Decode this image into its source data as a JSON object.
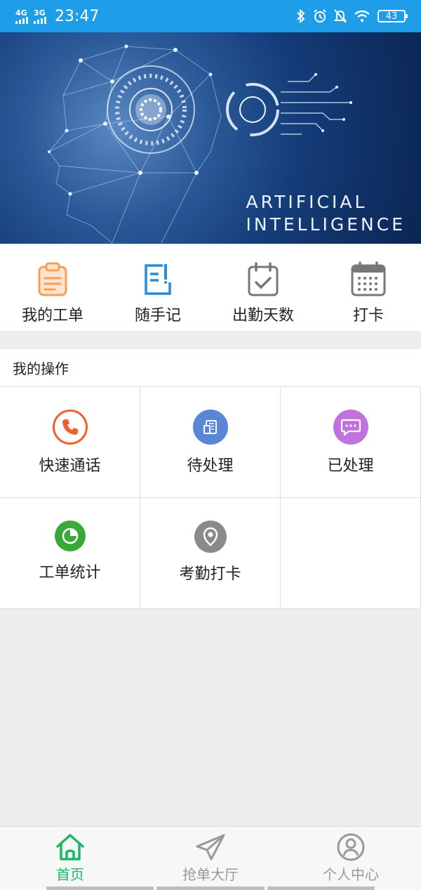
{
  "status_bar": {
    "network1": "4G",
    "network2": "3G",
    "time": "23:47",
    "battery": "43"
  },
  "banner": {
    "line1": "ARTIFICIAL",
    "line2": "INTELLIGENCE"
  },
  "quick_menu": [
    {
      "label": "我的工单",
      "icon": "clipboard-icon",
      "color": "#f5a05a"
    },
    {
      "label": "随手记",
      "icon": "note-edit-icon",
      "color": "#2a8ad6"
    },
    {
      "label": "出勤天数",
      "icon": "calendar-check-icon",
      "color": "#777777"
    },
    {
      "label": "打卡",
      "icon": "calendar-icon",
      "color": "#777777"
    }
  ],
  "operations": {
    "title": "我的操作",
    "items": [
      {
        "label": "快速通话",
        "icon": "phone-icon",
        "color": "#ef5f2f"
      },
      {
        "label": "待处理",
        "icon": "document-icon",
        "color": "#5a86d6"
      },
      {
        "label": "已处理",
        "icon": "message-icon",
        "color": "#c272dc"
      },
      {
        "label": "工单统计",
        "icon": "pie-chart-icon",
        "color": "#3aa93a"
      },
      {
        "label": "考勤打卡",
        "icon": "location-pin-icon",
        "color": "#8a8a8a"
      }
    ]
  },
  "bottom_nav": [
    {
      "label": "首页",
      "icon": "home-icon",
      "active": true
    },
    {
      "label": "抢单大厅",
      "icon": "send-icon",
      "active": false
    },
    {
      "label": "个人中心",
      "icon": "user-icon",
      "active": false
    }
  ],
  "colors": {
    "status_bar": "#1e9ee8",
    "accent": "#19b96a",
    "inactive": "#999999"
  }
}
